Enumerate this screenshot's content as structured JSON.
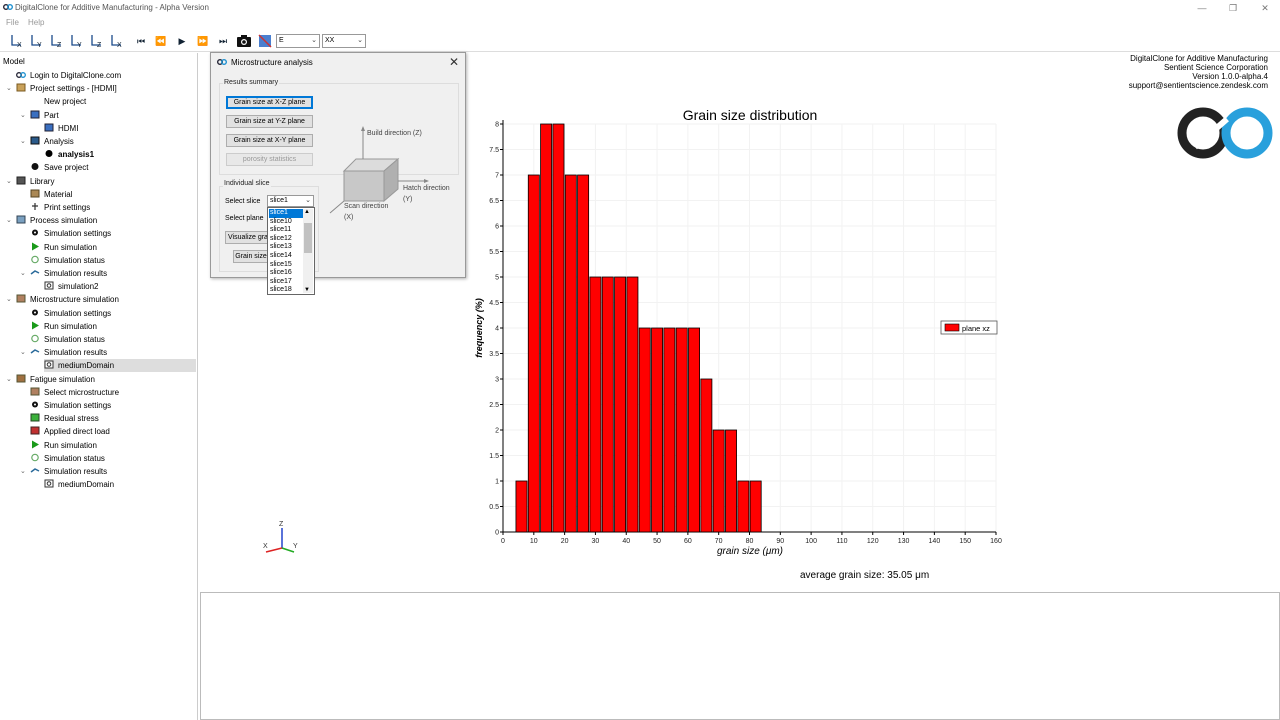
{
  "window": {
    "title": "DigitalClone for Additive Manufacturing - Alpha Version"
  },
  "menu": {
    "items": [
      "File",
      "Help"
    ]
  },
  "toolbar": {
    "axis_buttons": [
      "Y-X",
      "X-Y",
      "Y-Z",
      "Z-Y",
      "Z-X",
      "X-Z"
    ],
    "combo1": "E",
    "combo2": "XX"
  },
  "tree": {
    "header": "Model",
    "items": [
      {
        "label": "Login to DigitalClone.com",
        "level": 1,
        "icon": "logo-icon"
      },
      {
        "label": "Project settings - [HDMI]",
        "level": 1,
        "icon": "folder-icon",
        "toggle": true
      },
      {
        "label": "New project",
        "level": 2,
        "icon": "dot-icon"
      },
      {
        "label": "Part",
        "level": 2,
        "icon": "part-icon",
        "toggle": true
      },
      {
        "label": "HDMI",
        "level": 3,
        "icon": "part-icon"
      },
      {
        "label": "Analysis",
        "level": 2,
        "icon": "analysis-icon",
        "toggle": true
      },
      {
        "label": "analysis1",
        "level": 3,
        "icon": "circle-icon",
        "bold": true
      },
      {
        "label": "Save project",
        "level": 2,
        "icon": "save-icon"
      },
      {
        "label": "Library",
        "level": 1,
        "icon": "book-icon",
        "toggle": true
      },
      {
        "label": "Material",
        "level": 2,
        "icon": "material-icon"
      },
      {
        "label": "Print settings",
        "level": 2,
        "icon": "printer-icon"
      },
      {
        "label": "Process simulation",
        "level": 1,
        "icon": "process-icon",
        "toggle": true
      },
      {
        "label": "Simulation settings",
        "level": 2,
        "icon": "gear-icon"
      },
      {
        "label": "Run simulation",
        "level": 2,
        "icon": "play-icon"
      },
      {
        "label": "Simulation status",
        "level": 2,
        "icon": "status-icon"
      },
      {
        "label": "Simulation results",
        "level": 2,
        "icon": "results-icon",
        "toggle": true
      },
      {
        "label": "simulation2",
        "level": 3,
        "icon": "result-item-icon"
      },
      {
        "label": "Microstructure simulation",
        "level": 1,
        "icon": "micro-icon",
        "toggle": true
      },
      {
        "label": "Simulation settings",
        "level": 2,
        "icon": "gear-icon"
      },
      {
        "label": "Run simulation",
        "level": 2,
        "icon": "play-icon"
      },
      {
        "label": "Simulation status",
        "level": 2,
        "icon": "status-icon"
      },
      {
        "label": "Simulation results",
        "level": 2,
        "icon": "results-icon",
        "toggle": true
      },
      {
        "label": "mediumDomain",
        "level": 3,
        "icon": "result-item-icon",
        "selected": true
      },
      {
        "label": "Fatigue simulation",
        "level": 1,
        "icon": "fatigue-icon",
        "toggle": true
      },
      {
        "label": "Select microstructure",
        "level": 2,
        "icon": "micro-icon"
      },
      {
        "label": "Simulation settings",
        "level": 2,
        "icon": "gear-icon"
      },
      {
        "label": "Residual stress",
        "level": 2,
        "icon": "stress-icon"
      },
      {
        "label": "Applied direct load",
        "level": 2,
        "icon": "load-icon"
      },
      {
        "label": "Run simulation",
        "level": 2,
        "icon": "play-icon"
      },
      {
        "label": "Simulation status",
        "level": 2,
        "icon": "status-icon"
      },
      {
        "label": "Simulation results",
        "level": 2,
        "icon": "results-icon",
        "toggle": true
      },
      {
        "label": "mediumDomain",
        "level": 3,
        "icon": "result-item-icon"
      }
    ]
  },
  "dialog": {
    "title": "Microstructure analysis",
    "results_summary": "Results summary",
    "btn_xz": "Grain size at X-Z plane",
    "btn_yz": "Grain size at Y-Z plane",
    "btn_xy": "Grain size at X-Y plane",
    "btn_porosity": "porosity statistics",
    "individual_slice": "Individual slice",
    "select_slice": "Select slice",
    "select_plane": "Select plane",
    "visualize_btn": "Visualize gra",
    "grain_btn": "Grain size",
    "slice_value": "slice1",
    "build_dir": "Build direction (Z)",
    "hatch_dir": "Hatch direction (Y)",
    "scan_dir": "Scan direction (X)",
    "dropdown_options": [
      "slice1",
      "slice10",
      "slice11",
      "slice12",
      "slice13",
      "slice14",
      "slice15",
      "slice16",
      "slice17",
      "slice18"
    ]
  },
  "info": {
    "line1": "DigitalClone for Additive Manufacturing",
    "line2": "Sentient Science Corporation",
    "line3": "Version 1.0.0-alpha.4",
    "line4": "support@sentientscience.zendesk.com"
  },
  "chart_data": {
    "type": "bar",
    "title": "Grain size distribution",
    "xlabel": "grain size (μm)",
    "ylabel": "frequency (%)",
    "xlim": [
      0,
      160
    ],
    "ylim": [
      0,
      8
    ],
    "xticks": [
      0,
      10,
      20,
      30,
      40,
      50,
      60,
      70,
      80,
      90,
      100,
      110,
      120,
      130,
      140,
      150,
      160
    ],
    "yticks": [
      0,
      0.5,
      1,
      1.5,
      2,
      2.5,
      3,
      3.5,
      4,
      4.5,
      5,
      5.5,
      6,
      6.5,
      7,
      7.5,
      8
    ],
    "bin_width": 4,
    "series": [
      {
        "name": "plane xz",
        "color": "#ff0000",
        "x": [
          4,
          8,
          12,
          16,
          20,
          24,
          28,
          32,
          36,
          40,
          44,
          48,
          52,
          56,
          60,
          64,
          68,
          72,
          76,
          80
        ],
        "values": [
          1,
          7,
          8,
          8,
          7,
          7,
          5,
          5,
          5,
          5,
          4,
          4,
          4,
          4,
          4,
          3,
          2,
          2,
          1,
          1
        ]
      }
    ],
    "legend": "right",
    "grid": true
  },
  "avg_text": "average grain size: 35.05 μm"
}
